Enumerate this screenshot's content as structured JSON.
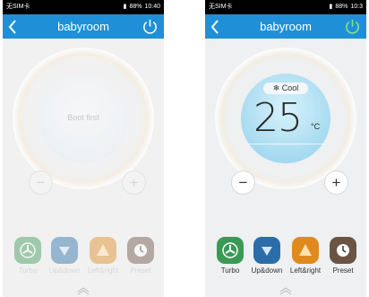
{
  "status_bar": {
    "carrier": "无SIM卡",
    "battery": "88%",
    "time_left": "10:40",
    "time_right": "10:3"
  },
  "header": {
    "title": "babyroom"
  },
  "left_screen": {
    "center_text": "Boot first"
  },
  "right_screen": {
    "mode": "Cool",
    "temperature": "25",
    "unit": "°C"
  },
  "controls": {
    "minus": "−",
    "plus": "+"
  },
  "functions": [
    {
      "label": "Turbo",
      "icon": "turbo-fan-icon",
      "color": "#3a9a55"
    },
    {
      "label": "Up&down",
      "icon": "updown-swing-icon",
      "color": "#2a6da8"
    },
    {
      "label": "Left&right",
      "icon": "leftright-swing-icon",
      "color": "#e08a1e"
    },
    {
      "label": "Preset",
      "icon": "clock-icon",
      "color": "#6b5444"
    }
  ],
  "colors": {
    "appbar": "#1f90d8",
    "disc_active": "#a6daf0"
  }
}
